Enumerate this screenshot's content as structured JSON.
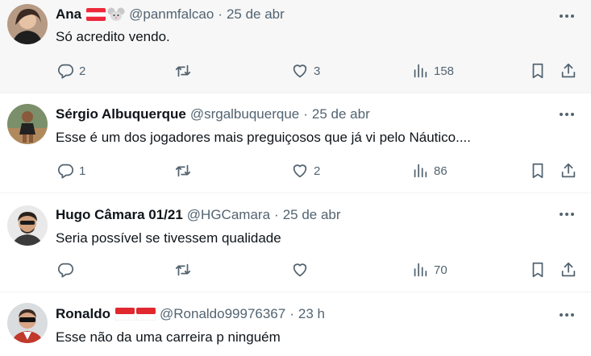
{
  "tweets": [
    {
      "name": "Ana",
      "flags": [
        "austria-flag-emoji",
        "mouse-face-emoji"
      ],
      "handle": "@panmfalcao",
      "time": "25 de abr",
      "text": "Só acredito vendo.",
      "replies": "2",
      "retweets": "",
      "likes": "3",
      "views": "158"
    },
    {
      "name": "Sérgio Albuquerque",
      "flags": [],
      "handle": "@srgalbuquerque",
      "time": "25 de abr",
      "text": "Esse é um dos jogadores mais preguiçosos que já vi pelo Náutico....",
      "replies": "1",
      "retweets": "",
      "likes": "2",
      "views": "86"
    },
    {
      "name": "Hugo Câmara 01/21",
      "flags": [],
      "handle": "@HGCamara",
      "time": "25 de abr",
      "text": "Seria possível se tivessem qualidade",
      "replies": "",
      "retweets": "",
      "likes": "",
      "views": "70"
    },
    {
      "name": "Ronaldo",
      "flags": [
        "red-white-flag",
        "red-white-flag"
      ],
      "handle": "@Ronaldo99976367",
      "time": "23 h",
      "text": "Esse não da uma carreira p ninguém"
    }
  ],
  "separator": "·",
  "colors": {
    "text": "#0f1419",
    "secondary": "#536471",
    "divider": "#eff3f4",
    "hover_bg": "#f7f7f7"
  }
}
